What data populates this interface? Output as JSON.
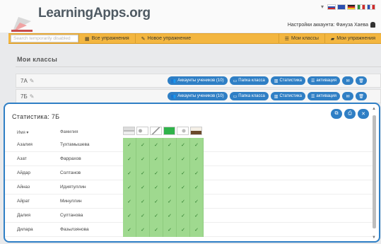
{
  "header": {
    "logo_text": "LearningApps",
    "logo_suffix": ".org",
    "account_label": "Настройки аккаунта: Фануза Хаева"
  },
  "flags": {
    "colors": [
      "#cf2a2a",
      "#2a4fb0",
      "#e34b3b",
      "#f0c419",
      "#2a8e3b"
    ]
  },
  "nav": {
    "search_placeholder": "Search temporarily disabled",
    "items": [
      {
        "label": "Все упражнения",
        "icon": "grid-icon"
      },
      {
        "label": "Новое упражнение",
        "icon": "pencil-icon"
      }
    ],
    "right_items": [
      {
        "label": "Мои классы",
        "icon": "list-icon"
      },
      {
        "label": "Мои упражнения",
        "icon": "folder-icon"
      }
    ]
  },
  "main": {
    "title": "Мои классы",
    "classes": [
      {
        "name": "7A"
      },
      {
        "name": "7Б"
      }
    ],
    "buttons": {
      "accounts": "Аккаунты учеников (10)",
      "folder": "Папка класса",
      "stats": "Статистика",
      "activation": "активация"
    }
  },
  "modal": {
    "title": "Статистика: 7Б",
    "col_name": "Имя",
    "col_surname": "Фамилия",
    "students": [
      {
        "first": "Азалия",
        "last": "Тухтамышева"
      },
      {
        "first": "Азат",
        "last": "Фаррахов"
      },
      {
        "first": "Айдар",
        "last": "Солтанов"
      },
      {
        "first": "Айназ",
        "last": "Идиятуллин"
      },
      {
        "first": "Айрат",
        "last": "Минуллин"
      },
      {
        "first": "Далия",
        "last": "Султанова"
      },
      {
        "first": "Дилара",
        "last": "Фазылзянова"
      }
    ],
    "check_mark": "✓",
    "exercise_count": 6
  },
  "colors": {
    "accent": "#2f7fc5",
    "nav_bg": "#f3b640",
    "cell_ok": "#9fd98f"
  }
}
